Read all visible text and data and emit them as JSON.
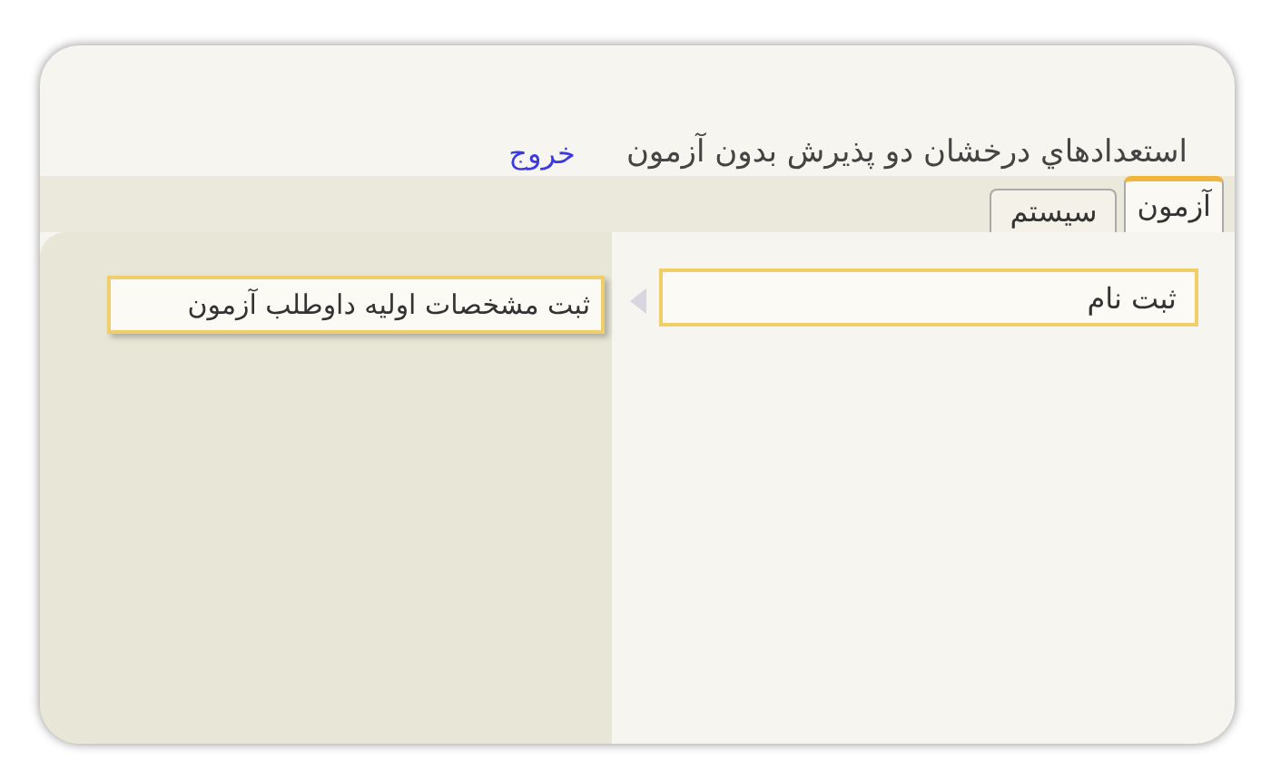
{
  "header": {
    "title": "استعدادهاي درخشان دو پذيرش بدون آزمون",
    "logout_link": "خروج"
  },
  "tabs": [
    {
      "label": "آزمون",
      "selected": true
    },
    {
      "label": "سيستم",
      "selected": false
    }
  ],
  "menu": {
    "items": [
      {
        "label": "ثبت نام",
        "expanded": true
      }
    ],
    "submenu": [
      {
        "label": "ثبت مشخصات اوليه داوطلب آزمون"
      }
    ]
  }
}
